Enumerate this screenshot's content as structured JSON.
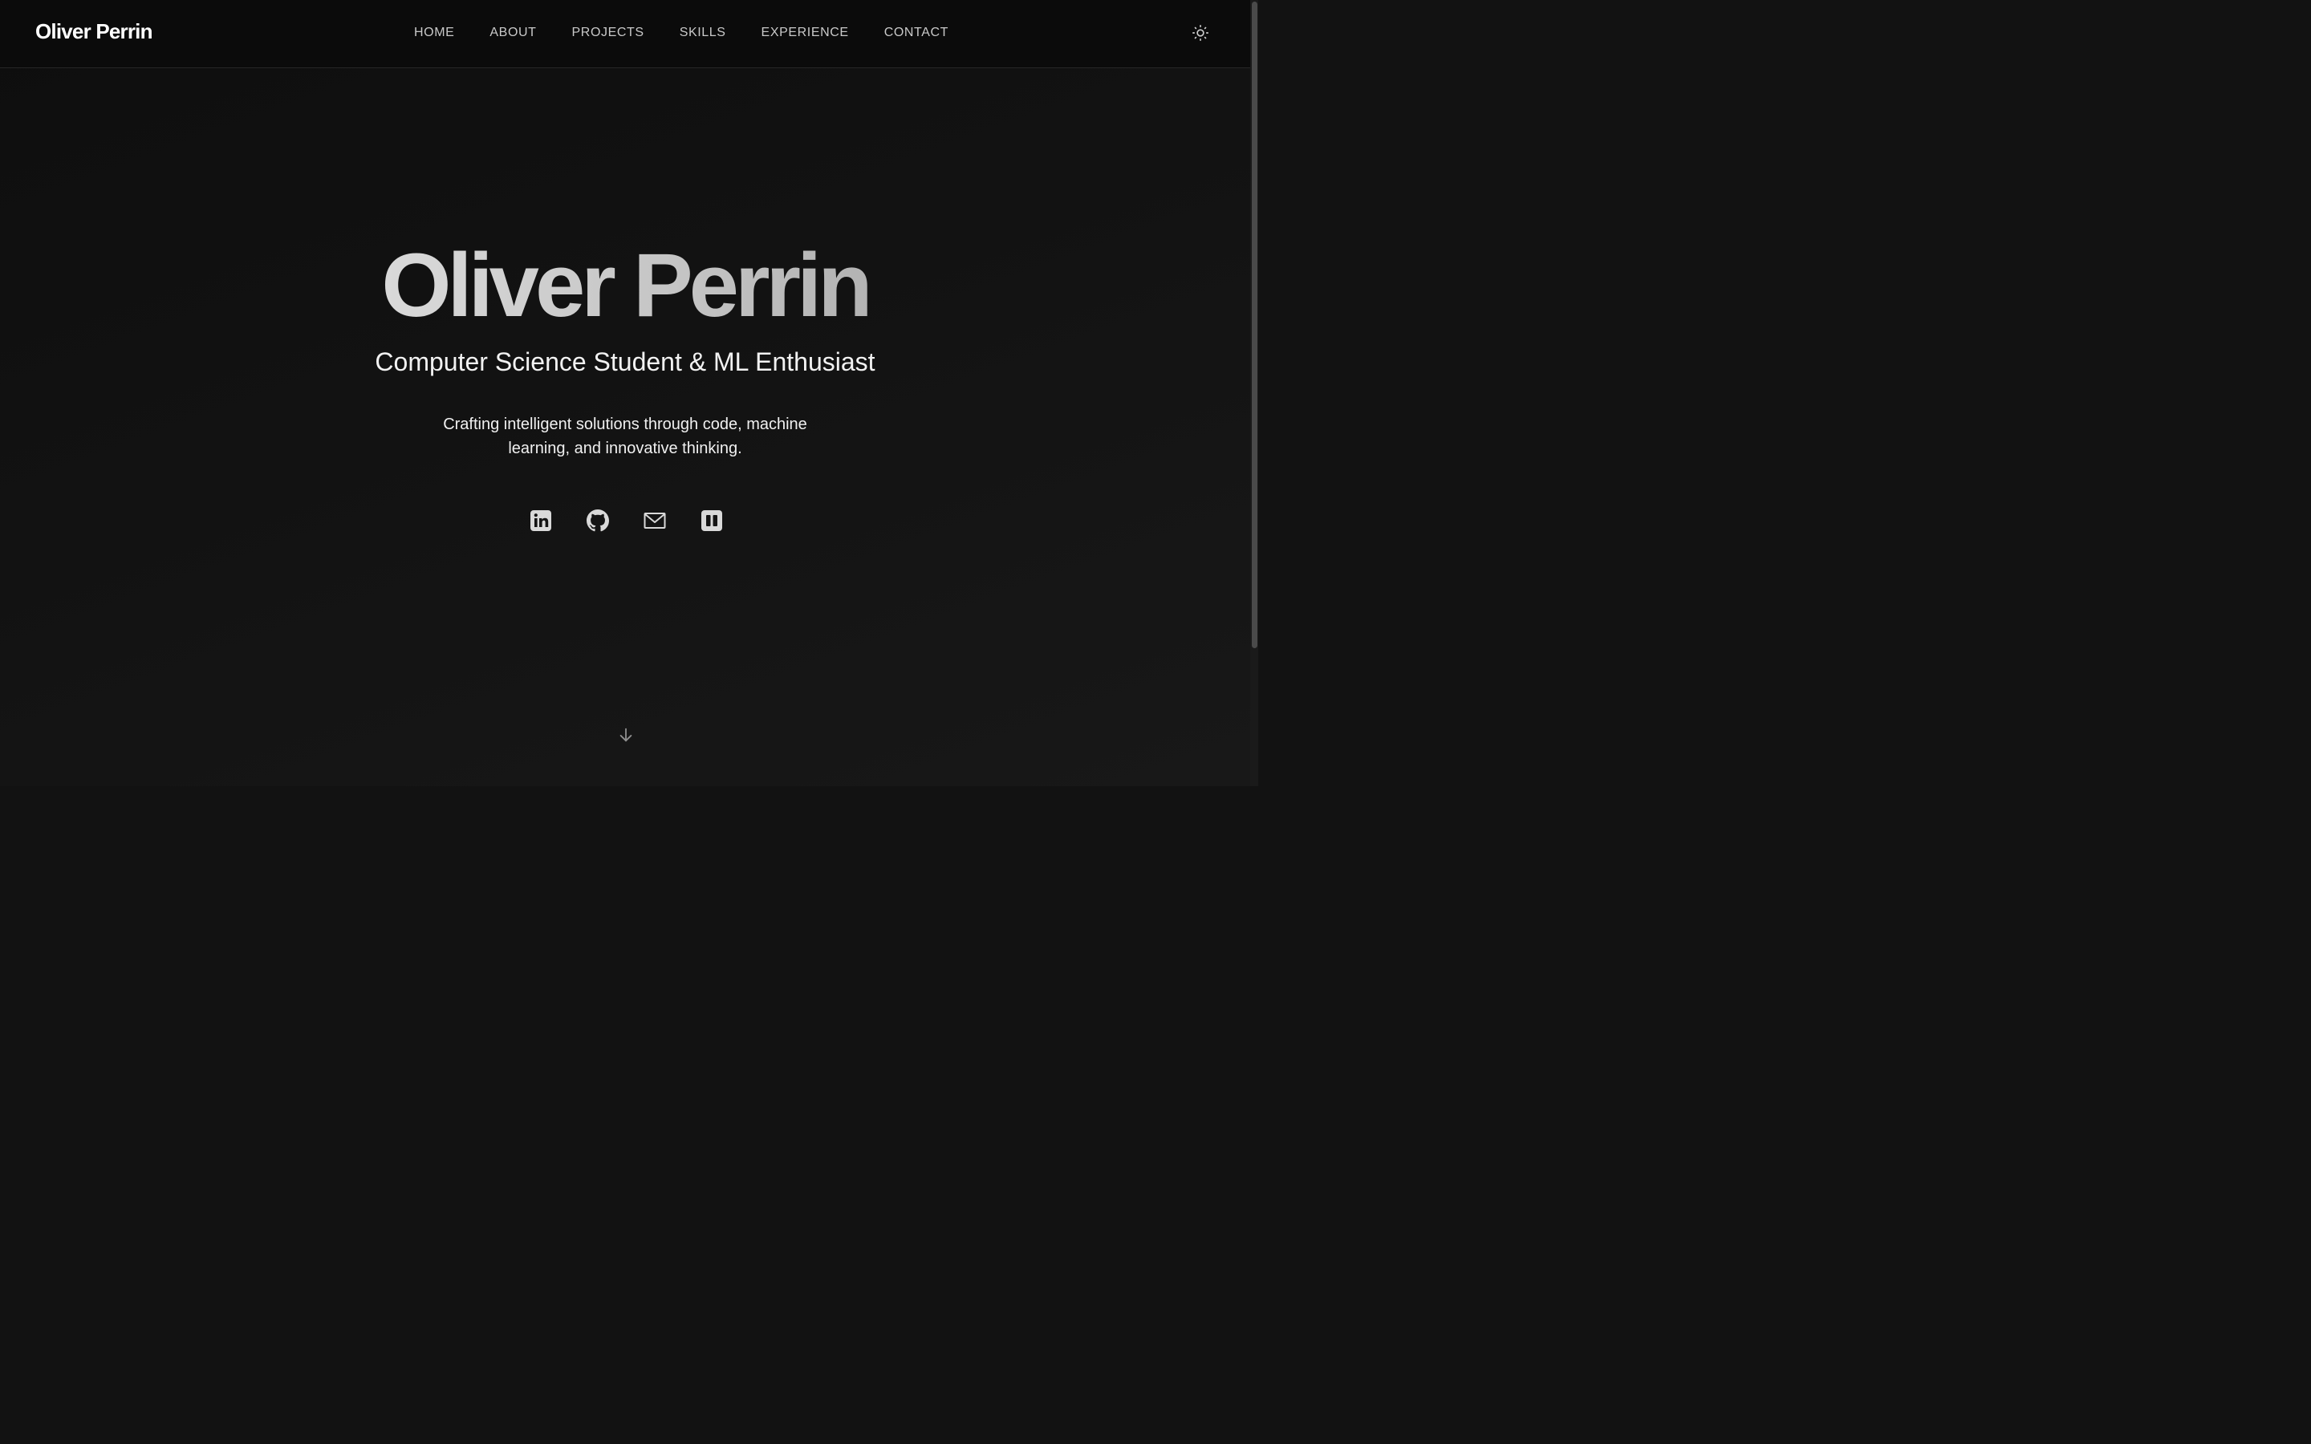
{
  "header": {
    "brand": "Oliver Perrin",
    "nav": [
      {
        "label": "HOME"
      },
      {
        "label": "ABOUT"
      },
      {
        "label": "PROJECTS"
      },
      {
        "label": "SKILLS"
      },
      {
        "label": "EXPERIENCE"
      },
      {
        "label": "CONTACT"
      }
    ],
    "theme_toggle_icon": "sun-icon"
  },
  "hero": {
    "name": "Oliver Perrin",
    "subtitle": "Computer Science Student & ML Enthusiast",
    "tagline_line1": "Crafting intelligent solutions through code, machine",
    "tagline_line2": "learning, and innovative thinking.",
    "socials": [
      {
        "icon": "linkedin-icon"
      },
      {
        "icon": "github-icon"
      },
      {
        "icon": "mail-icon"
      },
      {
        "icon": "pause-square-icon"
      }
    ],
    "scroll_icon": "arrow-down-icon"
  },
  "colors": {
    "background": "#121212",
    "header_background": "#0b0b0b",
    "nav_text": "#c9c9c9",
    "icon": "#d9d9d9"
  }
}
